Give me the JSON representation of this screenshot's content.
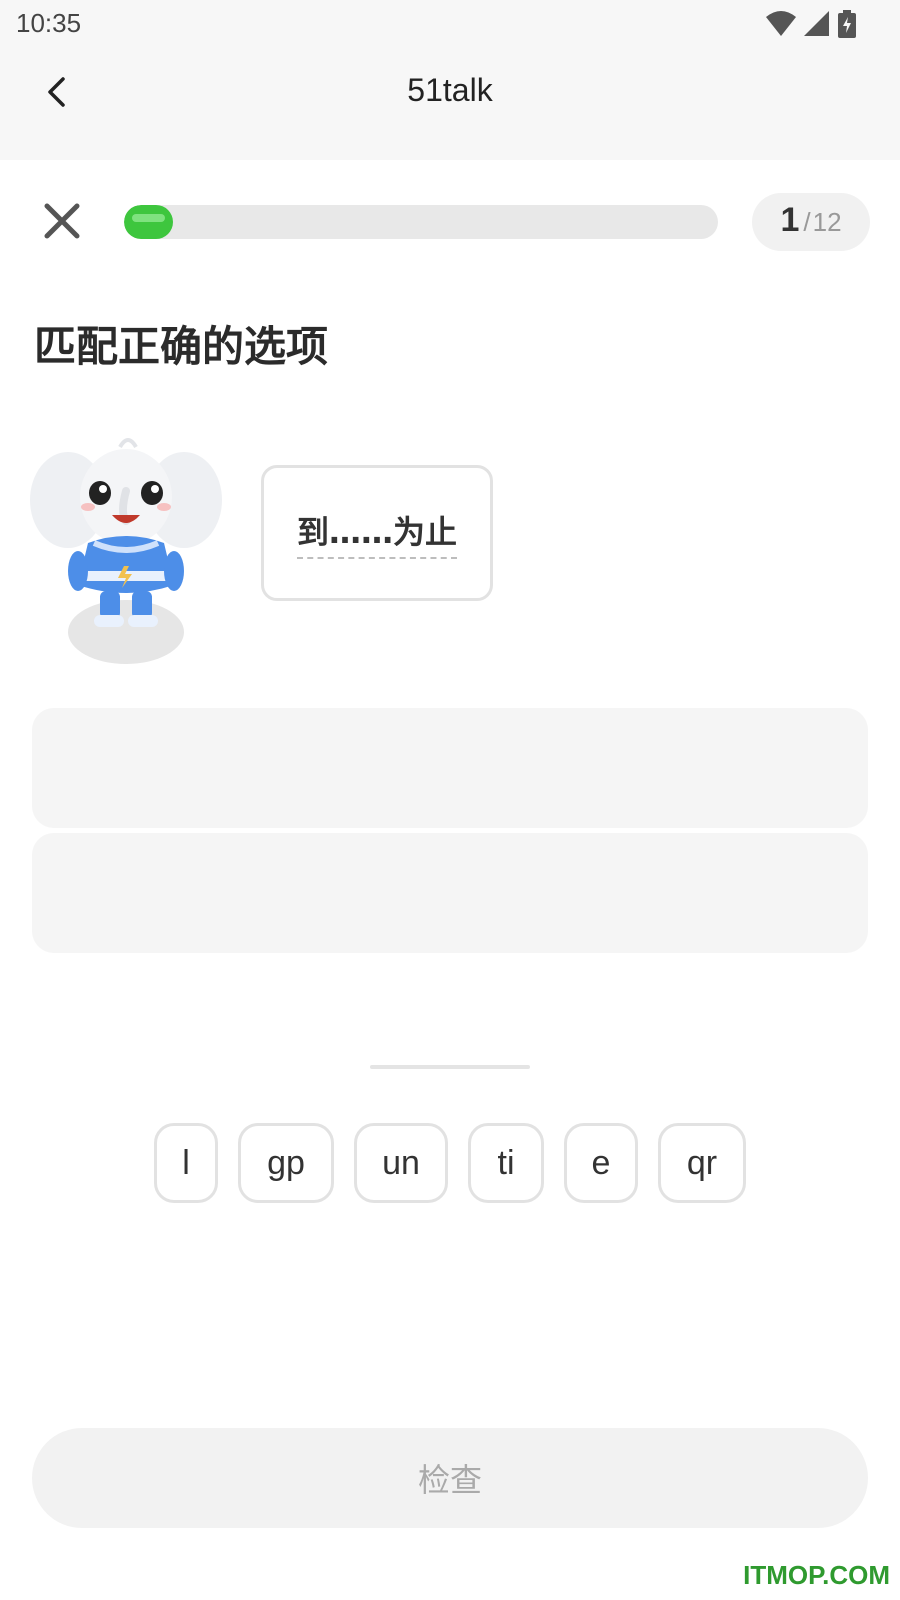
{
  "status_bar": {
    "time": "10:35",
    "icons": [
      "wifi-icon",
      "signal-icon",
      "battery-icon"
    ]
  },
  "app_bar": {
    "back_icon": "chevron-left-icon",
    "title": "51talk"
  },
  "quiz": {
    "close_icon": "close-icon",
    "progress": {
      "current": "1",
      "separator": "/",
      "total": "12",
      "fraction": 0.083
    },
    "prompt": "匹配正确的选项",
    "mascot": "elephant-mascot",
    "word": "到……为止",
    "answer_slots": 2,
    "options": [
      "l",
      "gp",
      "un",
      "ti",
      "e",
      "qr"
    ],
    "check_label": "检查"
  },
  "colors": {
    "progress": "#3ec63e",
    "watermark": "#2f9a2f"
  },
  "watermark": "ITMOP.COM"
}
